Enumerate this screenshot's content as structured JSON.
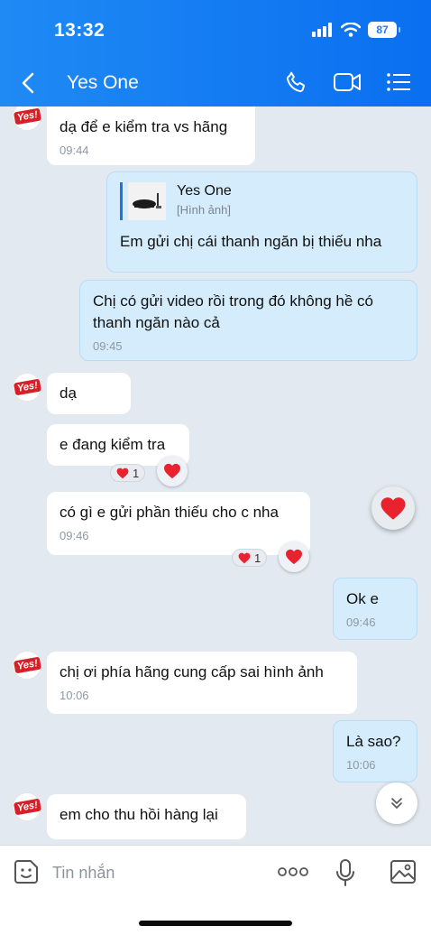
{
  "status_bar": {
    "time": "13:32",
    "battery": "87"
  },
  "header": {
    "title": "Yes One",
    "back_icon": "chevron-left-icon",
    "call_icon": "phone-icon",
    "video_icon": "video-camera-icon",
    "menu_icon": "list-icon"
  },
  "avatar_text": "Yes!",
  "messages": [
    {
      "text": "dạ để e kiểm tra vs hãng",
      "time": "09:44"
    },
    {
      "quote_name": "Yes One",
      "quote_sub": "[Hình ảnh]",
      "text": "Em gửi chị cái thanh ngăn bị thiếu nha"
    },
    {
      "text": "Chị có gửi video rồi trong đó không hề có thanh ngăn nào cả",
      "time": "09:45"
    },
    {
      "text": "dạ"
    },
    {
      "text": "e đang kiểm tra",
      "reaction_count": "1"
    },
    {
      "text": "có gì e gửi phần thiếu cho c nha",
      "time": "09:46",
      "reaction_count": "1"
    },
    {
      "text": "Ok e",
      "time": "09:46"
    },
    {
      "text": "chị ơi phía hãng cung cấp sai hình ảnh",
      "time": "10:06"
    },
    {
      "text": "Là sao?",
      "time": "10:06"
    },
    {
      "text": "em cho thu hồi hàng lại"
    }
  ],
  "composer": {
    "placeholder": "Tin nhắn",
    "sticker_icon": "sticker-icon",
    "more_icon": "more-dots-icon",
    "mic_icon": "microphone-icon",
    "image_icon": "image-icon"
  },
  "colors": {
    "header": "#0a6ff0",
    "background": "#e2e9f1",
    "outgoing": "#d4ecfc",
    "heart": "#e8232e"
  }
}
